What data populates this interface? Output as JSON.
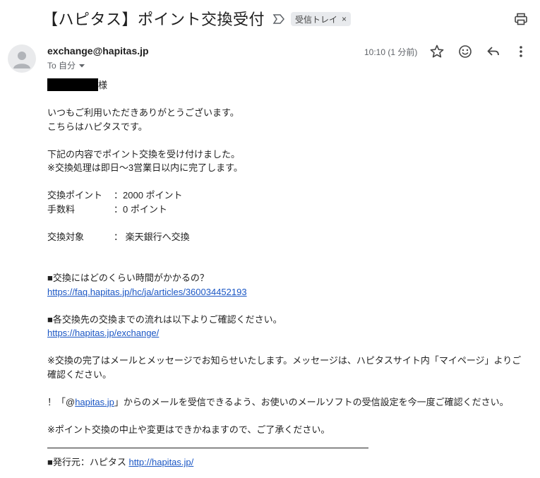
{
  "header": {
    "subject": "【ハピタス】ポイント交換受付",
    "label": "受信トレイ",
    "label_remove": "×"
  },
  "message": {
    "sender": "exchange@hapitas.jp",
    "to": "To 自分",
    "time": "10:10 (1 分前)"
  },
  "body": {
    "salutation_suffix": "様",
    "greeting1": "いつもご利用いただきありがとうございます。",
    "greeting2": "こちらはハピタスです。",
    "notice1": "下記の内容でポイント交換を受け付けました。",
    "notice2": "※交換処理は即日〜3営業日以内に完了します。",
    "points_key": "交換ポイント",
    "points_val": "：2000 ポイント",
    "fee_key": "手数料",
    "fee_val": "：0 ポイント",
    "target_key": "交換対象",
    "target_val": "： 楽天銀行へ交換",
    "q1": "■交換にはどのくらい時間がかかるの？",
    "link1": "https://faq.hapitas.jp/hc/ja/articles/360034452193",
    "q2": "■各交換先の交換までの流れは以下よりご確認ください。",
    "link2": "https://hapitas.jp/exchange/",
    "note1": "※交換の完了はメールとメッセージでお知らせいたします。メッセージは、ハピタスサイト内「マイページ」よりご確認ください。",
    "note2_pre": "！「@",
    "note2_link": "hapitas.jp",
    "note2_post": "」からのメールを受信できるよう、お使いのメールソフトの受信設定を今一度ご確認ください。",
    "note3": "※ポイント交換の中止や変更はできかねますので、ご了承ください。",
    "issuer_pre": "■発行元：ハピタス ",
    "issuer_link": "http://hapitas.jp/"
  },
  "icons": {
    "print": "print-icon",
    "label_arrow": "label-arrow-icon",
    "star": "star-icon",
    "emoji": "smile-icon",
    "reply": "reply-icon",
    "more": "more-vert-icon",
    "avatar": "person-icon",
    "dropdown": "caret-down-icon"
  },
  "colors": {
    "link": "#1a56c4",
    "chip_bg": "#e8eaed",
    "muted": "#5f6368"
  }
}
